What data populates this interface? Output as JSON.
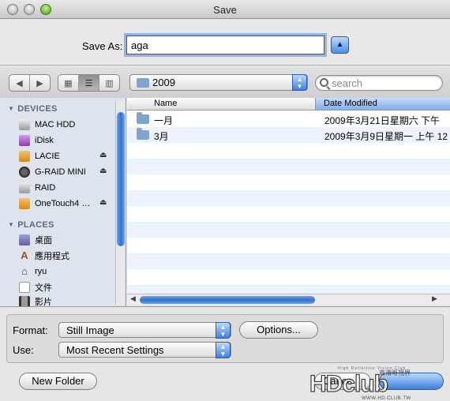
{
  "window": {
    "title": "Save"
  },
  "save_as": {
    "label": "Save As:",
    "value": "aga"
  },
  "toolbar": {
    "current_folder": "2009",
    "search_placeholder": "search"
  },
  "sidebar": {
    "devices_label": "DEVICES",
    "devices": [
      {
        "label": "MAC HDD",
        "icon": "hard-drive-icon",
        "eject": false
      },
      {
        "label": "iDisk",
        "icon": "idisk-icon",
        "eject": false
      },
      {
        "label": "LACIE",
        "icon": "external-drive-icon",
        "eject": true
      },
      {
        "label": "G-RAID MINI",
        "icon": "external-drive-icon",
        "eject": true
      },
      {
        "label": "RAID",
        "icon": "hard-drive-icon",
        "eject": false
      },
      {
        "label": "OneTouch4 …",
        "icon": "external-drive-icon",
        "eject": true
      }
    ],
    "places_label": "PLACES",
    "places": [
      {
        "label": "桌面",
        "icon": "desktop-icon"
      },
      {
        "label": "應用程式",
        "icon": "applications-icon"
      },
      {
        "label": "ryu",
        "icon": "home-icon"
      },
      {
        "label": "文件",
        "icon": "documents-icon"
      },
      {
        "label": "影片",
        "icon": "movies-icon"
      }
    ]
  },
  "file_list": {
    "columns": [
      "Name",
      "Date Modified"
    ],
    "rows": [
      {
        "name": "一月",
        "date": "2009年3月21日星期六 下午"
      },
      {
        "name": "3月",
        "date": "2009年3月9日星期一 上午 12"
      }
    ]
  },
  "options": {
    "format_label": "Format:",
    "format_value": "Still Image",
    "options_button": "Options...",
    "use_label": "Use:",
    "use_value": "Most Recent Settings"
  },
  "footer": {
    "new_folder": "New Folder",
    "cancel": "Cance",
    "save_partial": "Save"
  },
  "watermark": {
    "brand": "HDclub",
    "tagline": "High Definition Vision Club",
    "chinese": "高清晰視界",
    "url": "WWW.HD.CLUB.TW"
  }
}
